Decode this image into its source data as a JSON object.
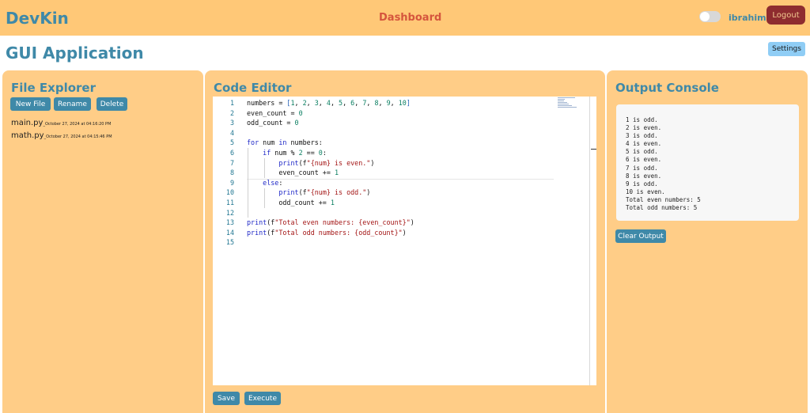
{
  "header": {
    "brand": "DevKin",
    "nav_link": "Dashboard",
    "username": "ibrahim",
    "logout_label": "Logout"
  },
  "page": {
    "title": "GUI Application",
    "settings_label": "Settings"
  },
  "file_explorer": {
    "title": "File Explorer",
    "buttons": {
      "new_file": "New File",
      "rename": "Rename",
      "delete": "Delete"
    },
    "files": [
      {
        "name": "main.py",
        "sep": "_",
        "timestamp": "October 27, 2024 at 04:16:20 PM"
      },
      {
        "name": "math.py",
        "sep": "_",
        "timestamp": "October 27, 2024 at 04:15:46 PM"
      }
    ]
  },
  "code_editor": {
    "title": "Code Editor",
    "line_numbers": [
      "1",
      "2",
      "3",
      "4",
      "5",
      "6",
      "7",
      "8",
      "9",
      "10",
      "11",
      "12",
      "13",
      "14",
      "15"
    ],
    "save_label": "Save",
    "execute_label": "Execute"
  },
  "output_console": {
    "title": "Output Console",
    "lines": [
      "1 is odd.",
      "2 is even.",
      "3 is odd.",
      "4 is even.",
      "5 is odd.",
      "6 is even.",
      "7 is odd.",
      "8 is even.",
      "9 is odd.",
      "10 is even.",
      "Total even numbers: 5",
      "Total odd numbers: 5"
    ],
    "clear_label": "Clear Output"
  },
  "colors": {
    "header_bg": "#ffc877",
    "panel_bg": "#ffcd87",
    "accent": "#3f89a8",
    "nav_link": "#d5553d",
    "logout_bg": "#8e2c2f",
    "settings_bg": "#8fcdf5"
  },
  "icons": {
    "theme_toggle": "toggle-switch-icon"
  }
}
